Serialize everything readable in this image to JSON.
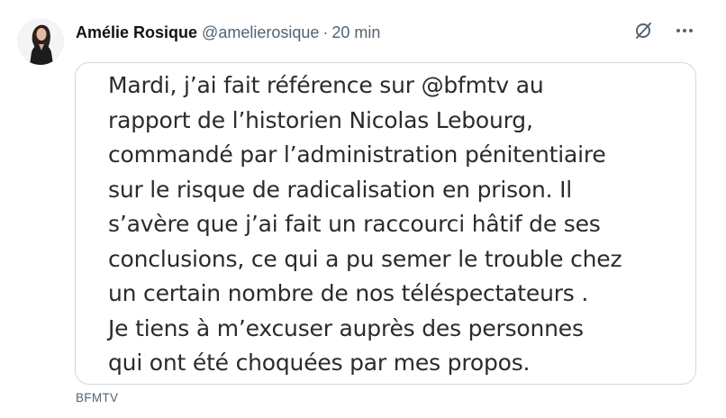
{
  "tweet": {
    "author_name": "Amélie Rosique",
    "handle": "@amelierosique",
    "separator": "·",
    "time": "20 min",
    "icons": {
      "grok": "grok-icon",
      "more": "more-options-icon"
    },
    "media": {
      "lines": [
        "Mardi, j’ai fait référence sur @bfmtv au",
        "rapport de l’historien Nicolas Lebourg,",
        "commandé par l’administration pénitentiaire",
        "sur le risque de radicalisation en prison. Il",
        "s’avère que j’ai fait un raccourci hâtif de ses",
        "conclusions, ce qui a pu semer le trouble chez",
        "un certain nombre de nos téléspectateurs .",
        "Je tiens à m’excuser auprès des personnes",
        "qui ont été choquées par mes propos."
      ]
    },
    "source": "BFMTV"
  }
}
